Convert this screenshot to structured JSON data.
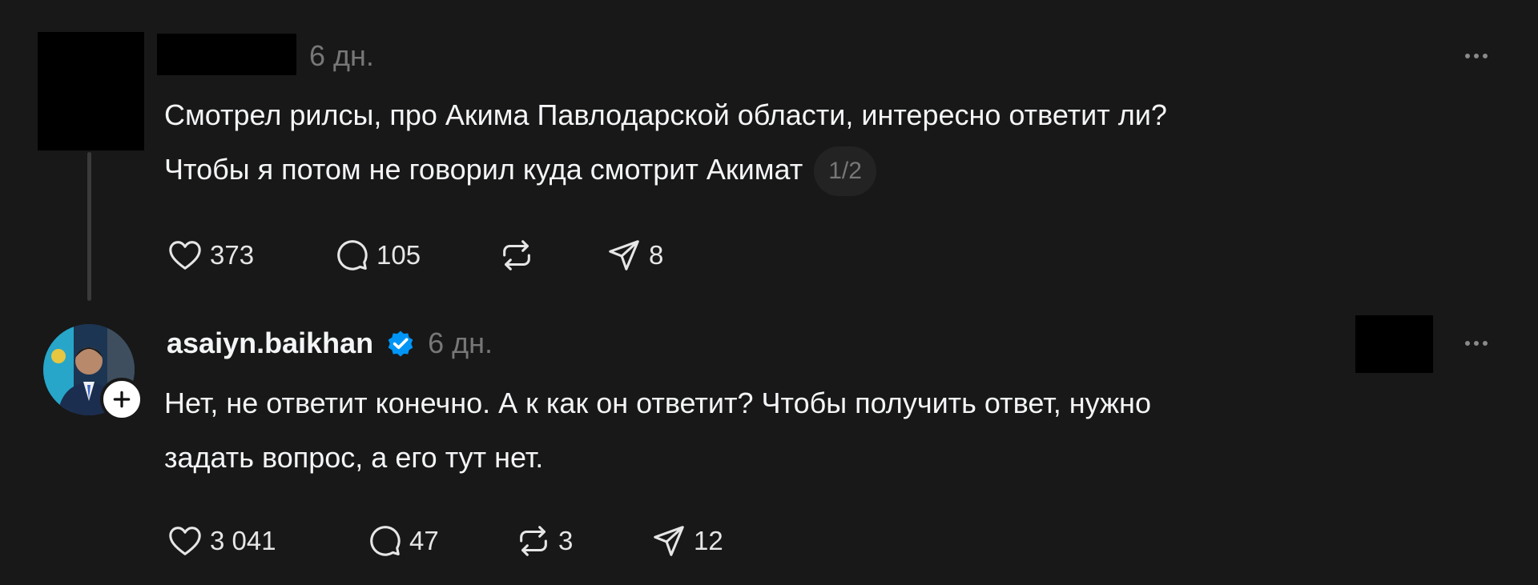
{
  "post1": {
    "time": "6 дн.",
    "text_line1": "Смотрел рилсы, про Акима Павлодарской области, интересно ответит ли?",
    "text_line2": "Чтобы я потом не говорил куда смотрит Акимат",
    "pager": "1/2",
    "likes": "373",
    "replies": "105",
    "shares": "8"
  },
  "post2": {
    "username": "asaiyn.baikhan",
    "time": "6 дн.",
    "text_line1": "Нет, не ответит конечно. А к как он ответит? Чтобы получить ответ, нужно",
    "text_line2": "задать вопрос, а его тут нет.",
    "likes": "3 041",
    "replies": "47",
    "reposts": "3",
    "shares": "12"
  },
  "icons": {
    "like": "heart-icon",
    "reply": "speech-bubble-icon",
    "repost": "repost-icon",
    "share": "send-icon",
    "more": "more-icon",
    "verified": "verified-badge-icon",
    "follow": "plus-icon"
  },
  "colors": {
    "background": "#181818",
    "text_primary": "#f3f5f7",
    "text_secondary": "#777777",
    "verified_blue": "#0095f6"
  }
}
